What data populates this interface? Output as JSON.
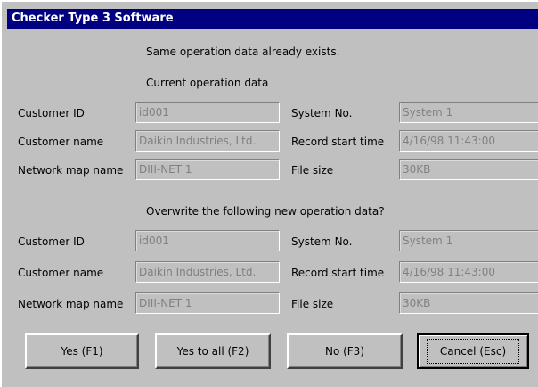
{
  "window": {
    "title": "Checker Type 3 Software"
  },
  "messages": {
    "exists": "Same operation data already exists.",
    "current_header": "Current operation data",
    "overwrite_header": "Overwrite the following new operation data?"
  },
  "current": {
    "customer_id_label": "Customer ID",
    "customer_id": "id001",
    "customer_name_label": "Customer name",
    "customer_name": "Daikin Industries, Ltd.",
    "network_map_label": "Network map name",
    "network_map": "DIII-NET 1",
    "system_no_label": "System No.",
    "system_no": "System 1",
    "record_start_label": "Record start time",
    "record_start": "4/16/98 11:43:00",
    "file_size_label": "File size",
    "file_size": "30KB"
  },
  "new": {
    "customer_id_label": "Customer ID",
    "customer_id": "id001",
    "customer_name_label": "Customer name",
    "customer_name": "Daikin Industries, Ltd.",
    "network_map_label": "Network map name",
    "network_map": "DIII-NET 1",
    "system_no_label": "System No.",
    "system_no": "System 1",
    "record_start_label": "Record start time",
    "record_start": "4/16/98 11:43:00",
    "file_size_label": "File size",
    "file_size": "30KB"
  },
  "buttons": {
    "yes": "Yes (F1)",
    "yes_all": "Yes to all (F2)",
    "no": "No (F3)",
    "cancel": "Cancel (Esc)"
  }
}
